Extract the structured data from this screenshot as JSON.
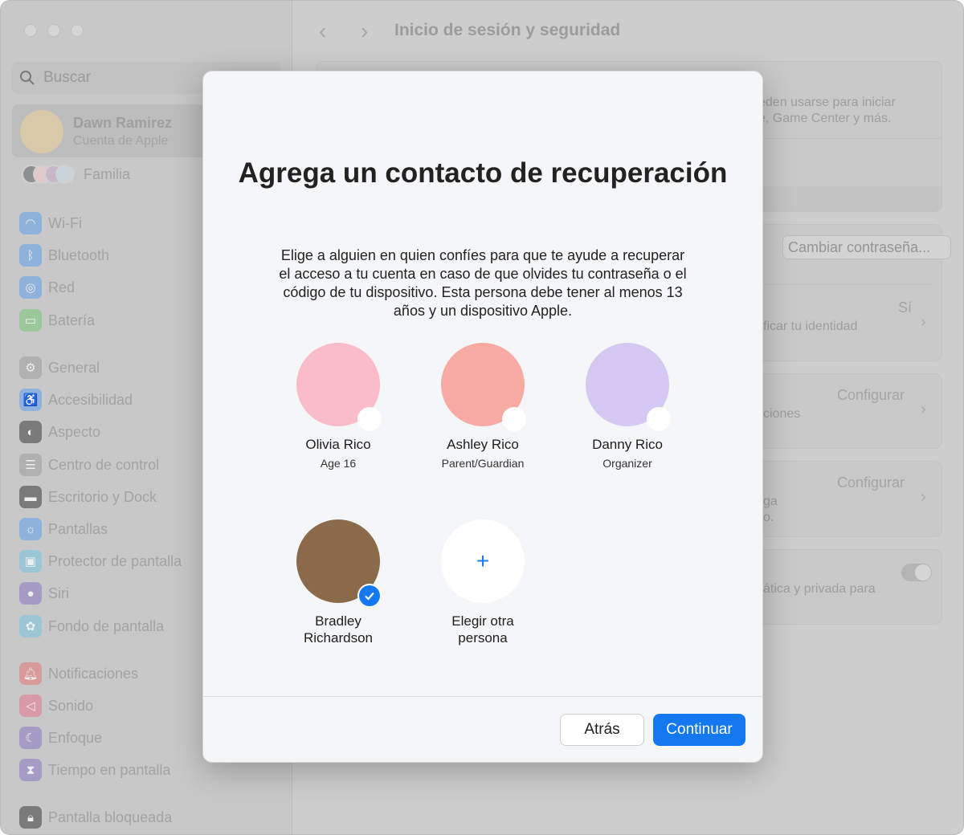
{
  "sidebar": {
    "search_placeholder": "Buscar",
    "account": {
      "name": "Dawn Ramirez",
      "subtitle": "Cuenta de Apple"
    },
    "family": "Familia",
    "items": [
      {
        "label": "Wi-Fi",
        "icon": "wifi-icon",
        "color": "#8fb2dc"
      },
      {
        "label": "Bluetooth",
        "icon": "bluetooth-icon",
        "color": "#8fb2dc"
      },
      {
        "label": "Red",
        "icon": "globe-icon",
        "color": "#8fb2dc"
      },
      {
        "label": "Batería",
        "icon": "battery-icon",
        "color": "#9cc79a"
      },
      {
        "label": "General",
        "icon": "gear-icon",
        "color": "#b0b0b0"
      },
      {
        "label": "Accesibilidad",
        "icon": "accessibility-icon",
        "color": "#8fb2dc"
      },
      {
        "label": "Aspecto",
        "icon": "appearance-icon",
        "color": "#7a7a7a"
      },
      {
        "label": "Centro de control",
        "icon": "control-center-icon",
        "color": "#b0b0b0"
      },
      {
        "label": "Escritorio y Dock",
        "icon": "dock-icon",
        "color": "#7a7a7a"
      },
      {
        "label": "Pantallas",
        "icon": "sun-icon",
        "color": "#8fb2dc"
      },
      {
        "label": "Protector de pantalla",
        "icon": "screensaver-icon",
        "color": "#9cc6d6"
      },
      {
        "label": "Siri",
        "icon": "siri-icon",
        "color": "#a49cc4"
      },
      {
        "label": "Fondo de pantalla",
        "icon": "wallpaper-icon",
        "color": "#9cc6d6"
      },
      {
        "label": "Notificaciones",
        "icon": "bell-icon",
        "color": "#d99a9a"
      },
      {
        "label": "Sonido",
        "icon": "speaker-icon",
        "color": "#d99aa8"
      },
      {
        "label": "Enfoque",
        "icon": "moon-icon",
        "color": "#a49cc4"
      },
      {
        "label": "Tiempo en pantalla",
        "icon": "hourglass-icon",
        "color": "#a49cc4"
      },
      {
        "label": "Pantalla bloqueada",
        "icon": "lock-icon",
        "color": "#7a7a7a"
      }
    ]
  },
  "main": {
    "title": "Inicio de sesión y seguridad",
    "card1": {
      "line1": "eden usarse para iniciar",
      "line2": "e, Game Center y más."
    },
    "card2": {
      "button": "Cambiar contraseña...",
      "value": "Sí",
      "text": "ficar tu identidad"
    },
    "card3": {
      "value": "Configurar",
      "text": "ciones"
    },
    "card4": {
      "value": "Configurar",
      "line1": "ga",
      "line2": "o."
    },
    "card5": {
      "text": "ática y privada para",
      "toggle_on": true
    }
  },
  "modal": {
    "title": "Agrega un contacto de recuperación",
    "description": "Elige a alguien en quien confíes para que te ayude a recuperar el acceso a tu cuenta en caso de que olvides tu contraseña o el código de tu dispositivo. Esta persona debe tener al menos 13 años y un dispositivo Apple.",
    "contacts": [
      {
        "name": "Olivia Rico",
        "role": "Age 16",
        "selected": false,
        "bg": "#f9bcc8"
      },
      {
        "name": "Ashley Rico",
        "role": "Parent/Guardian",
        "selected": false,
        "bg": "#f7aaa2"
      },
      {
        "name": "Danny Rico",
        "role": "Organizer",
        "selected": false,
        "bg": "#d5c8f2"
      },
      {
        "name": "Bradley Richardson",
        "role": "",
        "selected": true,
        "bg": "#8a6a4a"
      }
    ],
    "add_other": "Elegir otra persona",
    "back": "Atrás",
    "continue": "Continuar"
  },
  "colors": {
    "accent": "#1479f0"
  }
}
